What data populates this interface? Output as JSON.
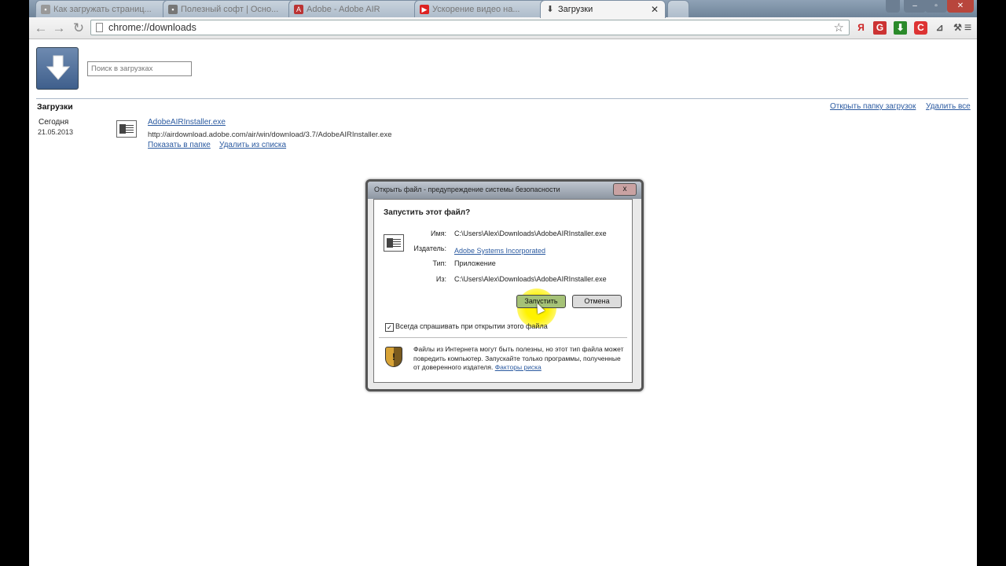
{
  "browser": {
    "tabs": [
      {
        "label": "Как загружать страниц...",
        "icon": "page-icon",
        "active": false
      },
      {
        "label": "Полезный софт | Осно...",
        "icon": "page-icon",
        "active": false
      },
      {
        "label": "Adobe - Adobe AIR",
        "icon": "adobe-icon",
        "active": false
      },
      {
        "label": "Ускорение видео на...",
        "icon": "youtube-icon",
        "active": false
      },
      {
        "label": "Загрузки",
        "icon": "download-icon",
        "active": true
      }
    ],
    "address": "chrome://downloads",
    "extensions": [
      "Я",
      "G",
      "C",
      "pin"
    ]
  },
  "downloads": {
    "search_placeholder": "Поиск в загрузках",
    "header_title": "Загрузки",
    "open_folder_link": "Открыть папку загрузок",
    "clear_all_link": "Удалить все",
    "date_label": "Сегодня",
    "date_value": "21.05.2013",
    "file": {
      "name": "AdobeAIRInstaller.exe",
      "url": "http://airdownload.adobe.com/air/win/download/3.7/AdobeAIRInstaller.exe",
      "show_in_folder": "Показать в папке",
      "remove_from_list": "Удалить из списка"
    }
  },
  "dialog": {
    "title": "Открыть файл - предупреждение системы безопасности",
    "close": "x",
    "question": "Запустить этот файл?",
    "fields": [
      {
        "label": "Имя:",
        "value": "C:\\Users\\Alex\\Downloads\\AdobeAIRInstaller.exe"
      },
      {
        "label": "Издатель:",
        "value": "Adobe Systems Incorporated"
      },
      {
        "label": "Тип:",
        "value": "Приложение"
      },
      {
        "label": "Из:",
        "value": "C:\\Users\\Alex\\Downloads\\AdobeAIRInstaller.exe"
      }
    ],
    "run_button": "Запустить",
    "cancel_button": "Отмена",
    "always_ask_label": "Всегда спрашивать при открытии этого файла",
    "always_ask_checked": true,
    "warning_text": "Файлы из Интернета могут быть полезны, но этот тип файла может повредить компьютер. Запускайте только программы, полученные от доверенного издателя.",
    "risk_link": "Факторы риска"
  }
}
